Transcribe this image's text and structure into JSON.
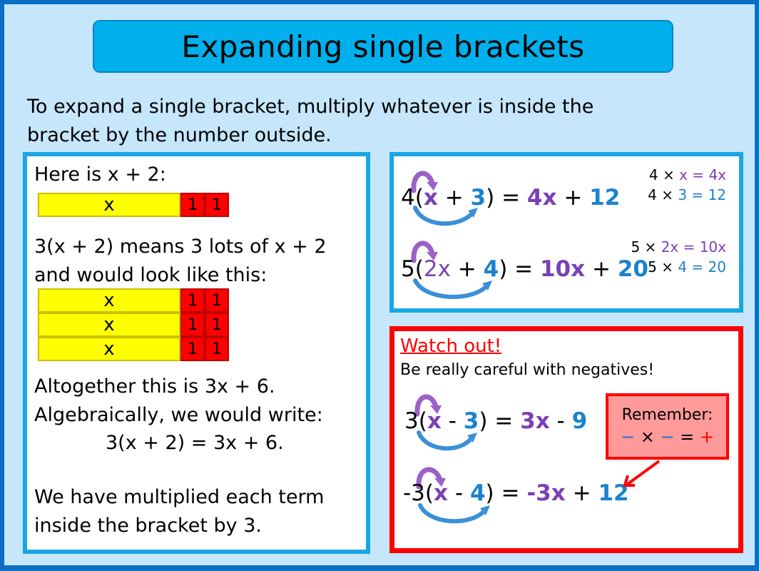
{
  "title": "Expanding single brackets",
  "intro": {
    "line1": "To expand a single bracket, multiply whatever is inside the",
    "line2": "bracket by the number outside."
  },
  "left_panel": {
    "here_is": "Here is x + 2:",
    "single_bar": {
      "x_label": "x",
      "units": [
        "1",
        "1"
      ]
    },
    "means_line1": "3(x + 2) means 3 lots of x + 2",
    "means_line2": "and would look like this:",
    "triple_bars": [
      {
        "x_label": "x",
        "units": [
          "1",
          "1"
        ]
      },
      {
        "x_label": "x",
        "units": [
          "1",
          "1"
        ]
      },
      {
        "x_label": "x",
        "units": [
          "1",
          "1"
        ]
      }
    ],
    "altogether": "Altogether this is 3x + 6.",
    "algebraically": "Algebraically, we would write:",
    "equation": "3(x + 2) = 3x + 6.",
    "summary_line1": "We have multiplied each term",
    "summary_line2": "inside the bracket by 3."
  },
  "examples": [
    {
      "multiplier": "4",
      "open": "(",
      "term1": "x",
      "op": " + ",
      "term2": "3",
      "close": ")",
      "equals": " = ",
      "result1": "4x",
      "result_op": " + ",
      "result2": "12",
      "working": [
        {
          "a": "4 × ",
          "b": "x",
          "eq": " = ",
          "c": "4x"
        },
        {
          "a": "4 × ",
          "b": "3",
          "eq": " = ",
          "c": "12"
        }
      ]
    },
    {
      "multiplier": "5",
      "open": "(",
      "term1": "2x",
      "op": " + ",
      "term2": "4",
      "close": ")",
      "equals": " = ",
      "result1": "10x",
      "result_op": " + ",
      "result2": "20",
      "working": [
        {
          "a": "5 × ",
          "b": "2x",
          "eq": " = ",
          "c": "10x"
        },
        {
          "a": "5 × ",
          "b": "4",
          "eq": " = ",
          "c": "20"
        }
      ]
    }
  ],
  "watch_out": {
    "heading": "Watch out!",
    "subheading": "Be really careful with negatives!",
    "examples": [
      {
        "multiplier": "3",
        "open": "(",
        "term1": "x",
        "op": " - ",
        "term2": "3",
        "close": ")",
        "equals": " = ",
        "result1": "3x",
        "result_op": " - ",
        "result2": "9"
      },
      {
        "multiplier": "-3",
        "open": "(",
        "term1": "x",
        "op": " - ",
        "term2": "4",
        "close": ")",
        "equals": " = ",
        "result1": "-3x",
        "result_op": " + ",
        "result2": "12"
      }
    ],
    "remember": {
      "title": "Remember:",
      "neg1": "−",
      "times": " × ",
      "neg2": "−",
      "equals": " = ",
      "plus": "+"
    }
  },
  "colors": {
    "frame": "#0b6fc2",
    "background": "#c5e6fb",
    "title_bar": "#00b0ec",
    "panel_border": "#1aa6e4",
    "warning_border": "#ff0000",
    "remember_fill": "#ff9a9a",
    "purple_term": "#7b3fb8",
    "blue_term": "#1a82cf",
    "x_tile": "#ffff00",
    "unit_tile": "#ff0000"
  }
}
